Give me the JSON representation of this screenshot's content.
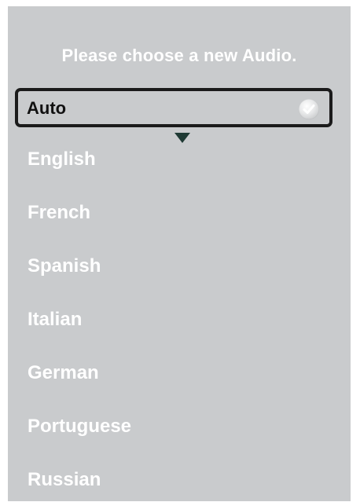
{
  "dialog": {
    "title": "Please choose a new Audio.",
    "selected_option": "Auto",
    "options": [
      "English",
      "French",
      "Spanish",
      "Italian",
      "German",
      "Portuguese",
      "Russian"
    ]
  },
  "icons": {
    "selected_marker": "checkmark-icon",
    "focus_pointer": "caret-down-icon"
  },
  "colors": {
    "panel_background": "#c9cbcd",
    "text": "#ffffff",
    "selection_border": "#1b1b1b",
    "pointer": "#1f3a34"
  }
}
